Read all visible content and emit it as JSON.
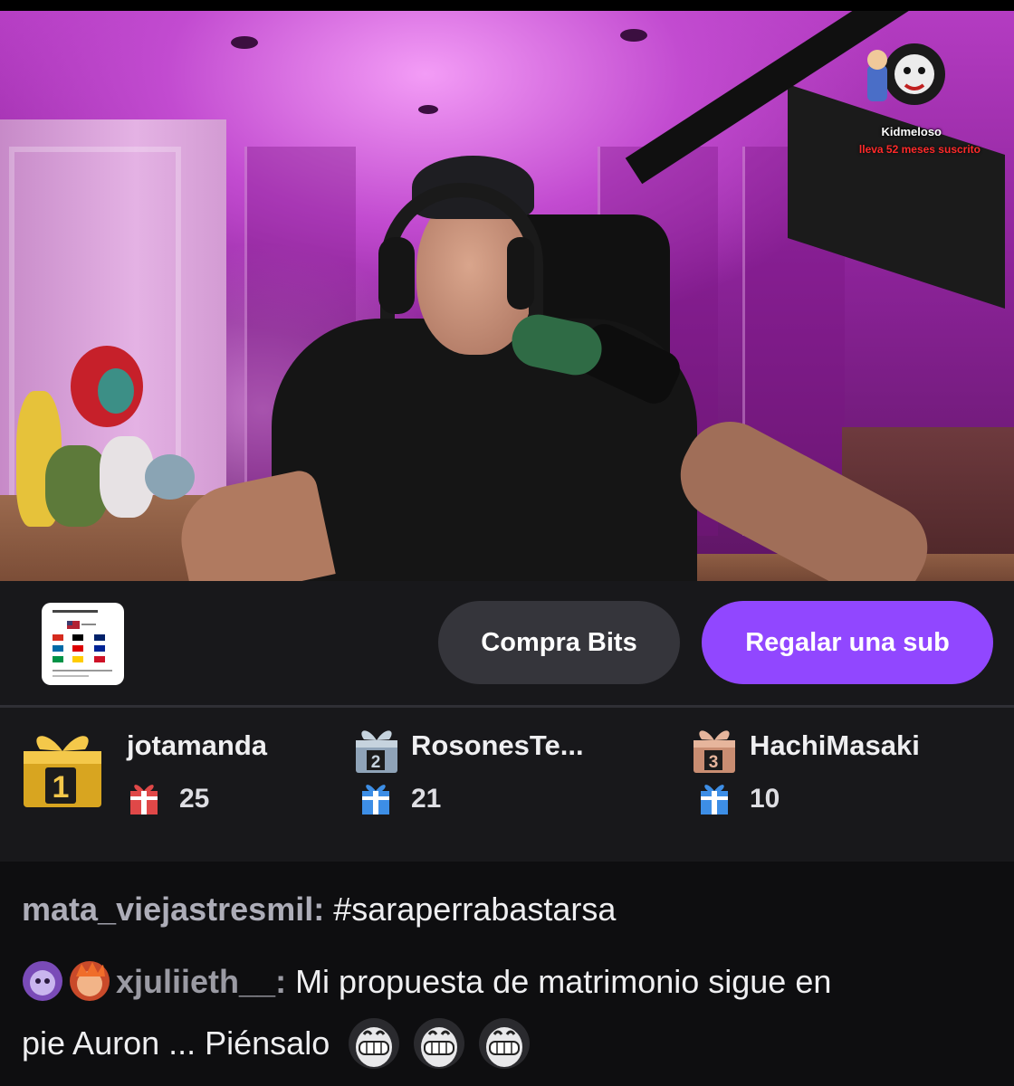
{
  "stream_overlay": {
    "subscriber_name": "Kidmeloso",
    "subscriber_message": "lleva 52 meses suscrito"
  },
  "actions": {
    "buy_bits_label": "Compra Bits",
    "gift_sub_label": "Regalar una sub"
  },
  "leaderboard": [
    {
      "rank": "1",
      "name": "jotamanda",
      "count": "25"
    },
    {
      "rank": "2",
      "name": "RosonesTe...",
      "count": "21"
    },
    {
      "rank": "3",
      "name": "HachiMasaki",
      "count": "10"
    }
  ],
  "chat": {
    "messages": [
      {
        "user": "mata_viejastresmil",
        "separator": ":",
        "text": " #saraperrabastarsa"
      },
      {
        "user": "xjuliieth__",
        "separator": ":",
        "text": " Mi propuesta de matrimonio sigue en",
        "text_line2": "pie Auron ... Piénsalo"
      }
    ]
  },
  "colors": {
    "accent": "#9147ff",
    "background": "#18181b",
    "chat_background": "#0e0e10"
  },
  "icons": [
    "gift-icon",
    "rank-gift-icon",
    "extension-thumbnail",
    "subscriber-badge",
    "penguin-emote"
  ]
}
